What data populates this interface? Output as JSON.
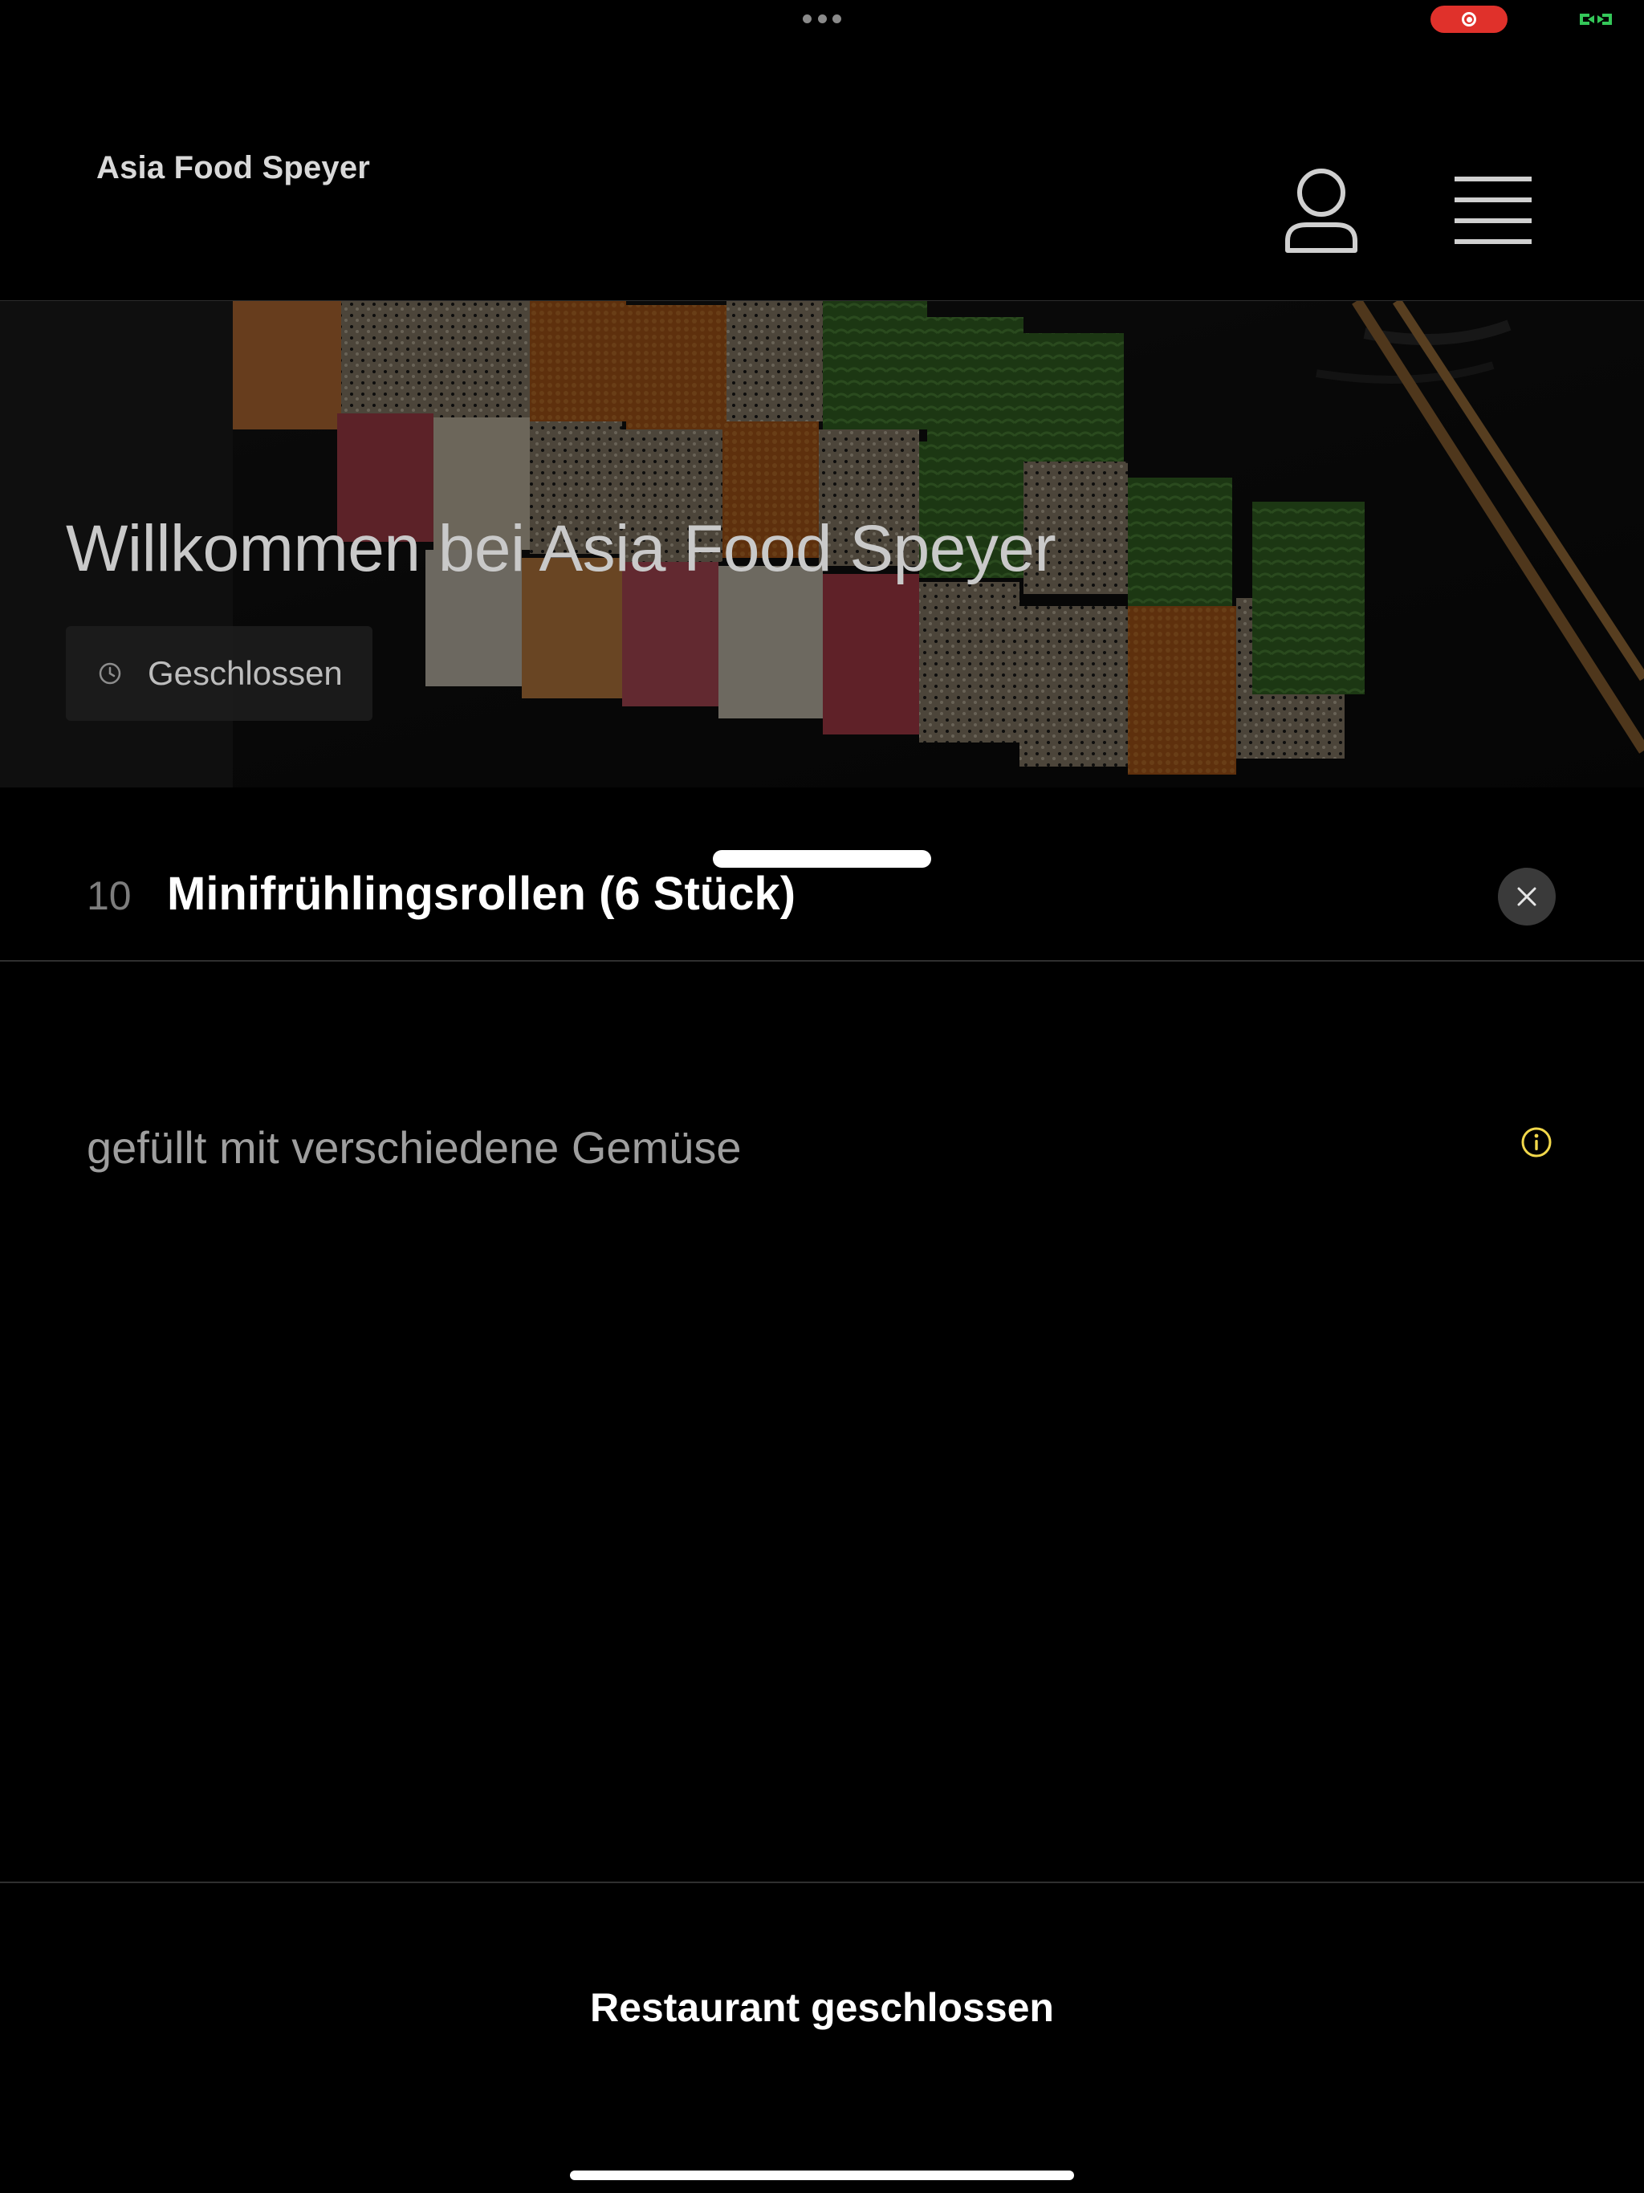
{
  "header": {
    "brand": "Asia Food Speyer"
  },
  "hero": {
    "title": "Willkommen bei Asia Food Speyer",
    "hours_status": "Geschlossen"
  },
  "item": {
    "number": "10",
    "name": "Minifrühlingsrollen (6 Stück)",
    "description": "gefüllt mit verschiedene Gemüse"
  },
  "footer": {
    "status": "Restaurant geschlossen"
  },
  "icons": {
    "user": "user-icon",
    "menu": "hamburger-menu-icon",
    "clock": "clock-icon",
    "close": "close-icon",
    "info": "info-icon"
  },
  "colors": {
    "background": "#000000",
    "accent_info": "#f2d84b",
    "recording": "#e0312b",
    "screen_mirroring": "#34c759"
  }
}
